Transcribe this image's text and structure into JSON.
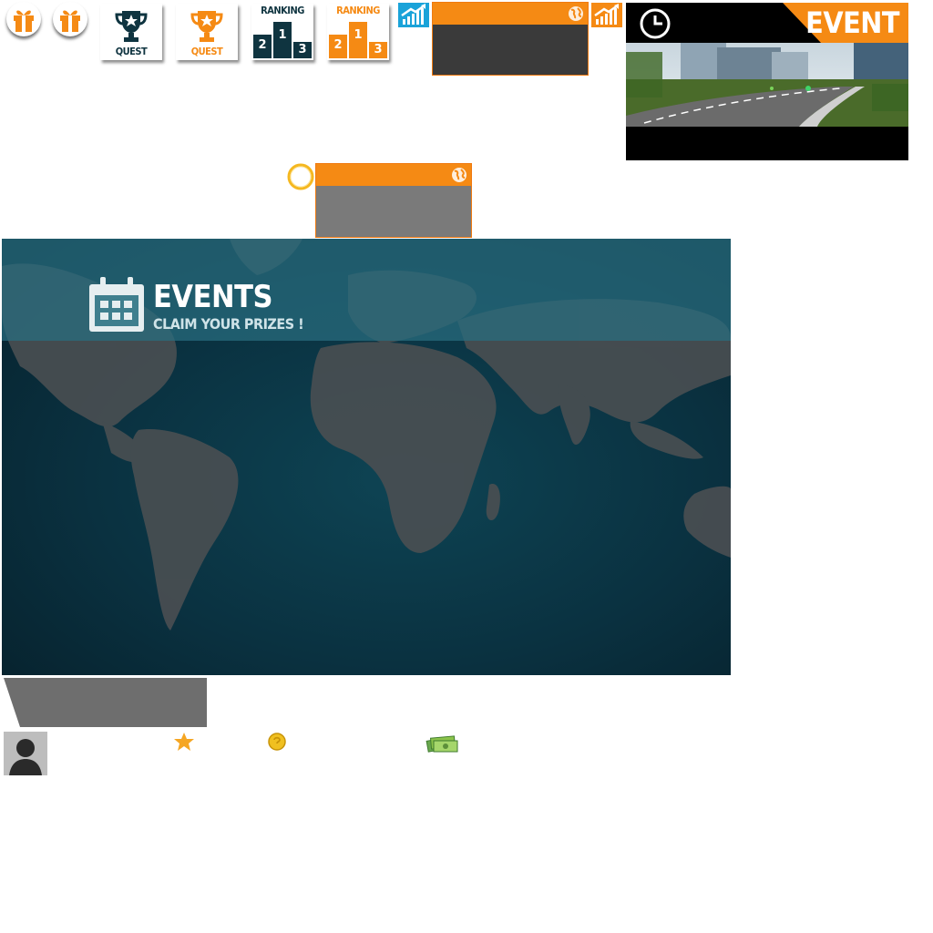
{
  "quest_tiles": [
    {
      "label": "QUEST",
      "color": "#0f3440"
    },
    {
      "label": "QUEST",
      "color": "#f58a14"
    }
  ],
  "ranking_tiles": [
    {
      "label": "RANKING",
      "color": "#0f3440",
      "podium": [
        "2",
        "1",
        "3"
      ]
    },
    {
      "label": "RANKING",
      "color": "#f58a14",
      "podium": [
        "2",
        "1",
        "3"
      ]
    }
  ],
  "event_card": {
    "badge": "EVENT",
    "accent": "#f58a14"
  },
  "events_panel": {
    "title": "EVENTS",
    "subtitle": "CLAIM YOUR PRIZES !"
  },
  "colors": {
    "orange": "#f58a14",
    "teal_dark": "#0f3440",
    "panel_gray": "#3a3a3a",
    "tab_gray": "#6e6e6e",
    "stat_blue": "#1aa3d9"
  },
  "icons": [
    "gift-icon",
    "trophy-icon",
    "podium-icon",
    "stats-icon",
    "globe-icon",
    "clock-icon",
    "calendar-icon",
    "loading-ring-icon",
    "avatar-icon",
    "star-icon",
    "coin-icon",
    "cash-icon"
  ]
}
